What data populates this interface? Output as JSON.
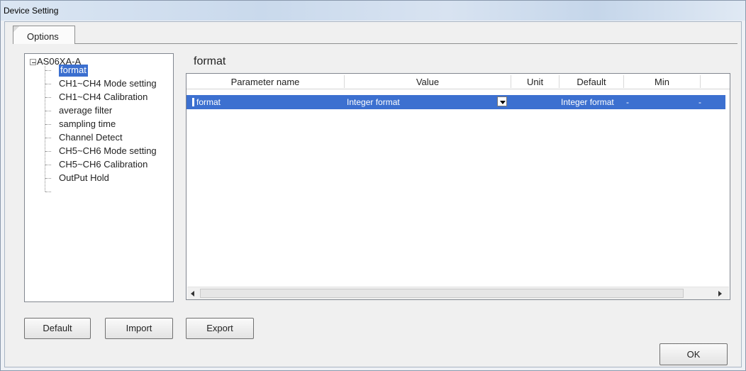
{
  "window": {
    "title": "Device Setting"
  },
  "tabs": [
    {
      "label": "Options",
      "active": true
    }
  ],
  "tree": {
    "root": {
      "label": "AS06XA-A",
      "expander": "⊟"
    },
    "items": [
      {
        "label": "format",
        "selected": true
      },
      {
        "label": "CH1~CH4 Mode setting"
      },
      {
        "label": "CH1~CH4 Calibration"
      },
      {
        "label": "average filter"
      },
      {
        "label": "sampling time"
      },
      {
        "label": "Channel Detect"
      },
      {
        "label": "CH5~CH6 Mode setting"
      },
      {
        "label": "CH5~CH6 Calibration"
      },
      {
        "label": "OutPut Hold"
      }
    ]
  },
  "main": {
    "section_title": "format",
    "grid": {
      "columns": [
        "Parameter name",
        "Value",
        "Unit",
        "Default",
        "Min"
      ],
      "rows": [
        {
          "parameter_name": "format",
          "value": "Integer format",
          "unit": "",
          "default": "Integer format",
          "min": "-",
          "max": "-"
        }
      ]
    }
  },
  "buttons": {
    "default": "Default",
    "import": "Import",
    "export": "Export",
    "ok": "OK"
  },
  "colors": {
    "selection": "#3b6fcf",
    "titlebar": "#c9d9ec"
  },
  "icons": [
    "tree-collapse-icon",
    "dropdown-arrow-icon",
    "scroll-left-icon",
    "scroll-right-icon"
  ]
}
